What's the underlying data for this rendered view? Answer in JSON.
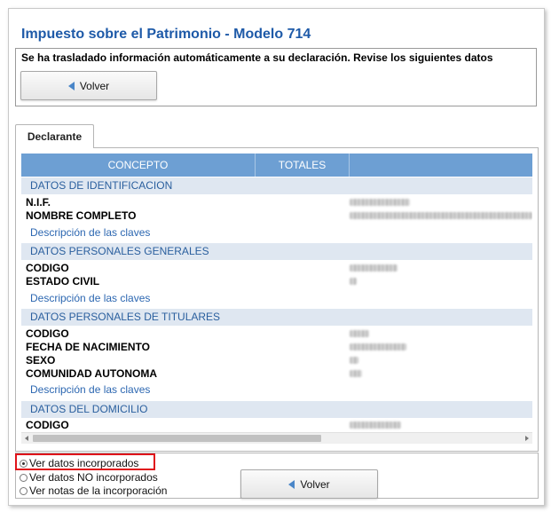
{
  "header": {
    "title": "Impuesto sobre el Patrimonio - Modelo 714",
    "notice": "Se ha trasladado información automáticamente a su declaración. Revise los siguientes datos"
  },
  "buttons": {
    "back_label": "Volver"
  },
  "tab": {
    "label": "Declarante"
  },
  "grid": {
    "columns": [
      "CONCEPTO",
      "TOTALES",
      ""
    ],
    "sections": [
      {
        "title": "DATOS DE IDENTIFICACION",
        "rows": [
          "N.I.F.",
          "NOMBRE COMPLETO"
        ],
        "link": "Descripción de las claves"
      },
      {
        "title": "DATOS PERSONALES GENERALES",
        "rows": [
          "CODIGO",
          "ESTADO CIVIL"
        ],
        "link": "Descripción de las claves"
      },
      {
        "title": "DATOS PERSONALES DE TITULARES",
        "rows": [
          "CODIGO",
          "FECHA DE NACIMIENTO",
          "SEXO",
          "COMUNIDAD AUTONOMA"
        ],
        "link": "Descripción de las claves"
      },
      {
        "title": "DATOS DEL DOMICILIO",
        "rows": [
          "CODIGO"
        ]
      }
    ]
  },
  "options": {
    "radios": [
      "Ver datos incorporados",
      "Ver datos NO incorporados",
      "Ver notas de la incorporación"
    ],
    "selected": "Ver datos incorporados"
  },
  "colors": {
    "title": "#1e5aa8",
    "grid_header": "#6d9fd3",
    "section_bg": "#dfe7f1",
    "link": "#2c67b1",
    "highlight": "#e0141b"
  }
}
